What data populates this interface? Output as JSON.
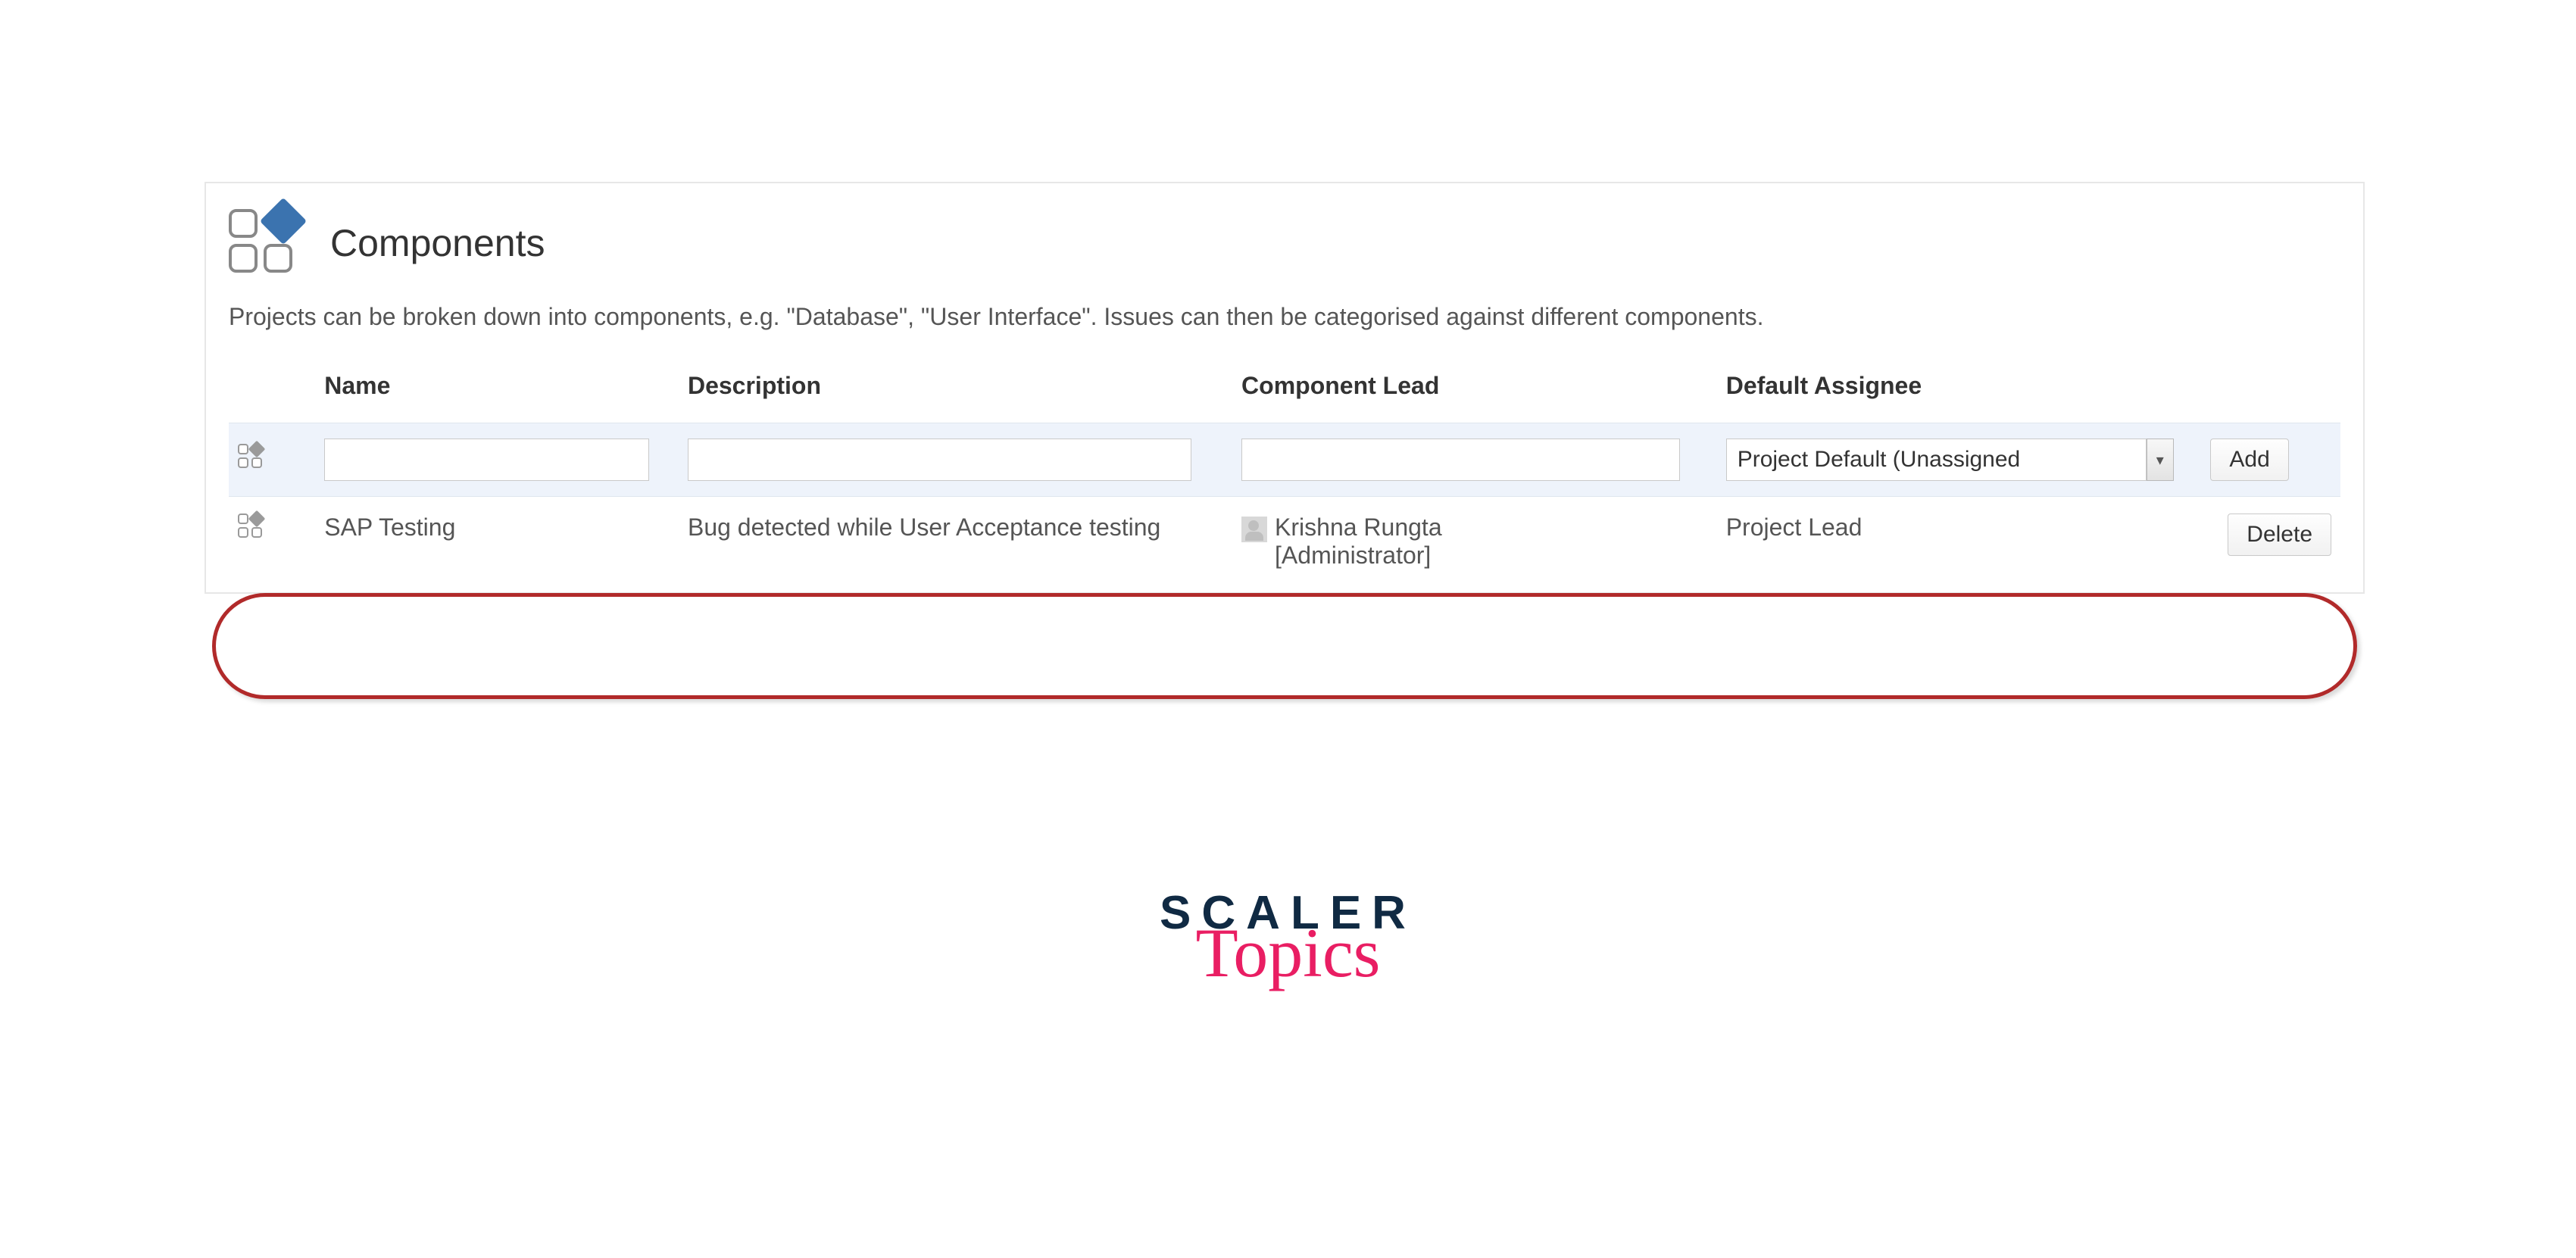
{
  "header": {
    "title": "Components",
    "description": "Projects can be broken down into components, e.g. \"Database\", \"User Interface\". Issues can then be categorised against different components."
  },
  "columns": {
    "name": "Name",
    "description": "Description",
    "lead": "Component Lead",
    "assignee": "Default Assignee"
  },
  "inputs": {
    "name_value": "",
    "description_value": "",
    "lead_value": "",
    "assignee_selected": "Project Default (Unassigned",
    "add_label": "Add"
  },
  "rows": [
    {
      "name": "SAP Testing",
      "description": "Bug detected while User Acceptance testing",
      "lead_name": "Krishna Rungta",
      "lead_role": "[Administrator]",
      "assignee": "Project Lead",
      "action_label": "Delete"
    }
  ],
  "branding": {
    "line1": "SCALER",
    "line2": "Topics"
  }
}
